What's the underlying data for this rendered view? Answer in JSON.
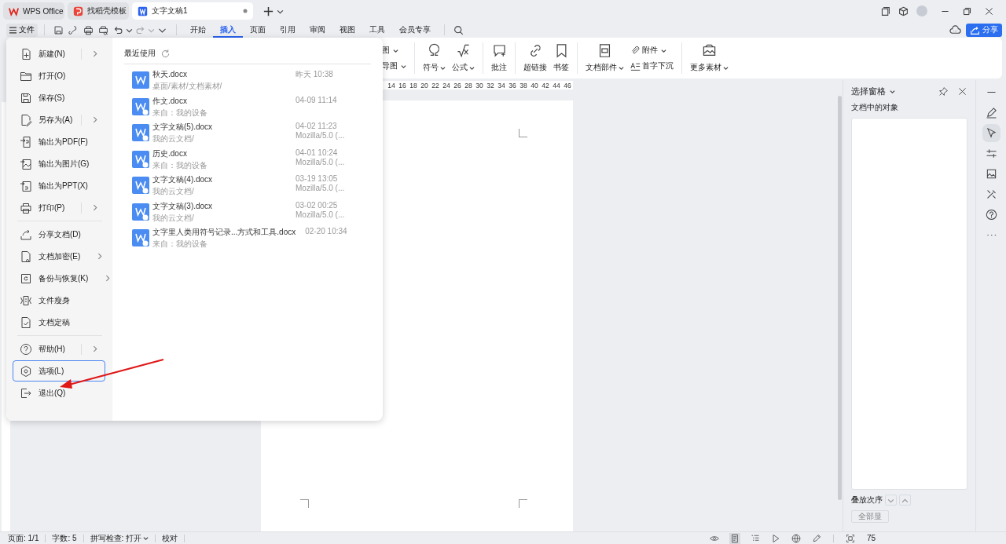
{
  "tabs": [
    {
      "label": "WPS Office",
      "kind": "wps",
      "selected": false
    },
    {
      "label": "找稻壳模板",
      "kind": "template",
      "selected": false
    },
    {
      "label": "文字文稿1",
      "kind": "doc",
      "selected": true
    }
  ],
  "file_button": "文件",
  "menu_tabs": [
    {
      "label": "开始",
      "selected": false
    },
    {
      "label": "插入",
      "selected": true
    },
    {
      "label": "页面",
      "selected": false
    },
    {
      "label": "引用",
      "selected": false
    },
    {
      "label": "审阅",
      "selected": false
    },
    {
      "label": "视图",
      "selected": false
    },
    {
      "label": "工具",
      "selected": false
    },
    {
      "label": "会员专享",
      "selected": false
    }
  ],
  "share_button": "分享",
  "ribbon": [
    {
      "kind": "stack",
      "items": [
        {
          "label": "图",
          "dropdown": true
        },
        {
          "label": "导图",
          "dropdown": true
        }
      ]
    },
    {
      "kind": "divider"
    },
    {
      "kind": "large",
      "items": [
        {
          "label": "符号",
          "dropdown": true
        }
      ]
    },
    {
      "kind": "large",
      "items": [
        {
          "label": "公式",
          "dropdown": true
        }
      ]
    },
    {
      "kind": "divider"
    },
    {
      "kind": "large",
      "items": [
        {
          "label": "批注",
          "dropdown": false
        }
      ]
    },
    {
      "kind": "divider"
    },
    {
      "kind": "large",
      "items": [
        {
          "label": "超链接",
          "dropdown": false
        }
      ]
    },
    {
      "kind": "large",
      "items": [
        {
          "label": "书签",
          "dropdown": false
        }
      ]
    },
    {
      "kind": "divider"
    },
    {
      "kind": "large",
      "items": [
        {
          "label": "文档部件",
          "dropdown": true
        }
      ]
    },
    {
      "kind": "stack",
      "items": [
        {
          "label": "附件",
          "dropdown": true
        },
        {
          "label": "首字下沉",
          "dropdown": false
        }
      ]
    },
    {
      "kind": "divider"
    },
    {
      "kind": "large",
      "items": [
        {
          "label": "更多素材",
          "dropdown": true
        }
      ]
    }
  ],
  "ruler": [
    "14",
    "16",
    "18",
    "20",
    "22",
    "24",
    "26",
    "28",
    "30",
    "32",
    "34",
    "36",
    "38",
    "40",
    "42",
    "44",
    "46"
  ],
  "file_menu": {
    "groups": [
      [
        {
          "label": "新建(N)",
          "submenu": true,
          "selected": false
        },
        {
          "label": "打开(O)",
          "submenu": false,
          "selected": false
        },
        {
          "label": "保存(S)",
          "submenu": false,
          "selected": false
        },
        {
          "label": "另存为(A)",
          "submenu": true,
          "selected": false
        },
        {
          "label": "输出为PDF(F)",
          "submenu": false,
          "selected": false
        },
        {
          "label": "输出为图片(G)",
          "submenu": false,
          "selected": false
        },
        {
          "label": "输出为PPT(X)",
          "submenu": false,
          "selected": false
        },
        {
          "label": "打印(P)",
          "submenu": true,
          "selected": false
        }
      ],
      [
        {
          "label": "分享文档(D)",
          "submenu": false,
          "selected": false
        },
        {
          "label": "文档加密(E)",
          "submenu": true,
          "selected": false
        },
        {
          "label": "备份与恢复(K)",
          "submenu": true,
          "selected": false
        },
        {
          "label": "文件瘦身",
          "submenu": false,
          "selected": false
        },
        {
          "label": "文档定稿",
          "submenu": false,
          "selected": false
        }
      ],
      [
        {
          "label": "帮助(H)",
          "submenu": true,
          "selected": false
        },
        {
          "label": "选项(L)",
          "submenu": false,
          "selected": true
        },
        {
          "label": "退出(Q)",
          "submenu": false,
          "selected": false
        }
      ]
    ],
    "recent_title": "最近使用",
    "recent_files": [
      {
        "name": "秋天.docx",
        "location": "桌面/素材/文档素材/",
        "time": "昨天 10:38"
      },
      {
        "name": "作文.docx",
        "location": "来自：我的设备",
        "time": "04-09 11:14"
      },
      {
        "name": "文字文稿(5).docx",
        "location": "我的云文档/",
        "time": "04-02 11:23",
        "source": "Mozilla/5.0 (..."
      },
      {
        "name": "历史.docx",
        "location": "来自：我的设备",
        "time": "04-01 10:24",
        "source": "Mozilla/5.0 (..."
      },
      {
        "name": "文字文稿(4).docx",
        "location": "我的云文档/",
        "time": "03-19 13:05",
        "source": "Mozilla/5.0 (..."
      },
      {
        "name": "文字文稿(3).docx",
        "location": "我的云文档/",
        "time": "03-02 00:25",
        "source": "Mozilla/5.0 (..."
      },
      {
        "name": "文字里人类用符号记录...方式和工具.docx",
        "location": "来自：我的设备",
        "time": "02-20 10:34"
      }
    ]
  },
  "selection_pane": {
    "title": "选择窗格",
    "objects_label": "文档中的对象",
    "order_label": "叠放次序",
    "show_all": "全部显"
  },
  "status_bar": {
    "items": [
      {
        "label": "页面: 1/1",
        "dropdown": false
      },
      {
        "label": "字数: 5",
        "dropdown": false
      },
      {
        "label": "拼写检查: 打开",
        "dropdown": true
      },
      {
        "label": "校对",
        "dropdown": false
      }
    ],
    "view_modes": [
      {
        "selected": false
      },
      {
        "selected": true
      },
      {
        "selected": false
      },
      {
        "selected": false
      },
      {
        "selected": false
      },
      {
        "selected": false
      }
    ],
    "zoom": "75"
  }
}
